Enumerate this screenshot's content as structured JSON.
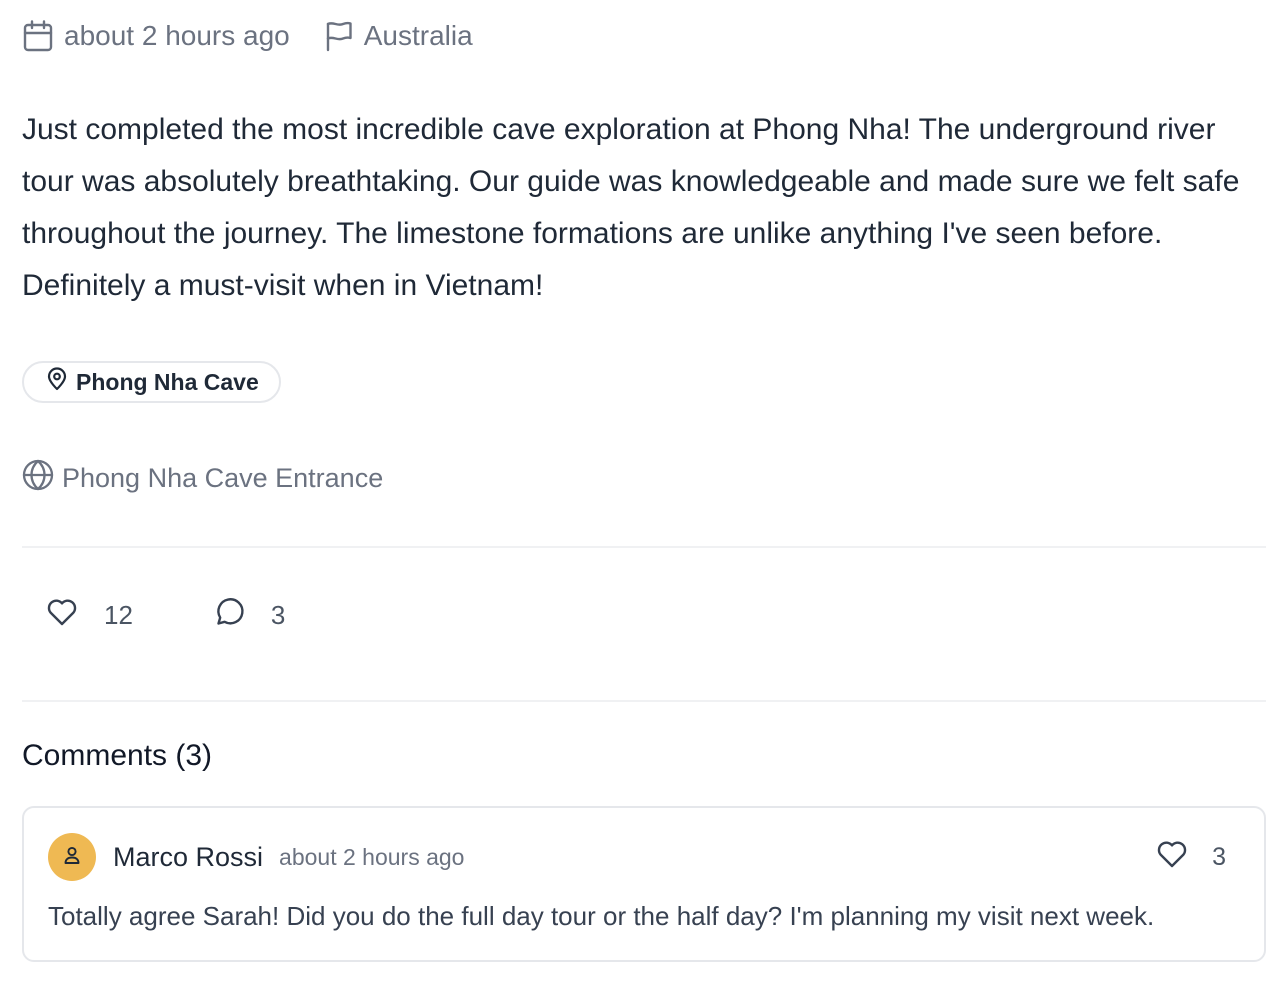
{
  "post": {
    "timestamp": "about 2 hours ago",
    "country": "Australia",
    "body": "Just completed the most incredible cave exploration at Phong Nha! The underground river tour was absolutely breathtaking. Our guide was knowledgeable and made sure we felt safe throughout the journey. The limestone formations are unlike anything I've seen before. Definitely a must-visit when in Vietnam!",
    "tag": "Phong Nha Cave",
    "place": "Phong Nha Cave Entrance",
    "likes": "12",
    "comments_count": "3"
  },
  "comments": {
    "title": "Comments (3)",
    "items": [
      {
        "author": "Marco Rossi",
        "time": "about 2 hours ago",
        "likes": "3",
        "text": "Totally agree Sarah! Did you do the full day tour or the half day? I'm planning my visit next week.",
        "avatar_color": "#efb953"
      }
    ]
  },
  "icons": {
    "date": "calendar-icon",
    "country": "flag-icon",
    "tag": "map-pin-icon",
    "place": "globe-icon",
    "like": "heart-icon",
    "comment": "comment-bubble-icon",
    "avatar": "user-icon"
  }
}
